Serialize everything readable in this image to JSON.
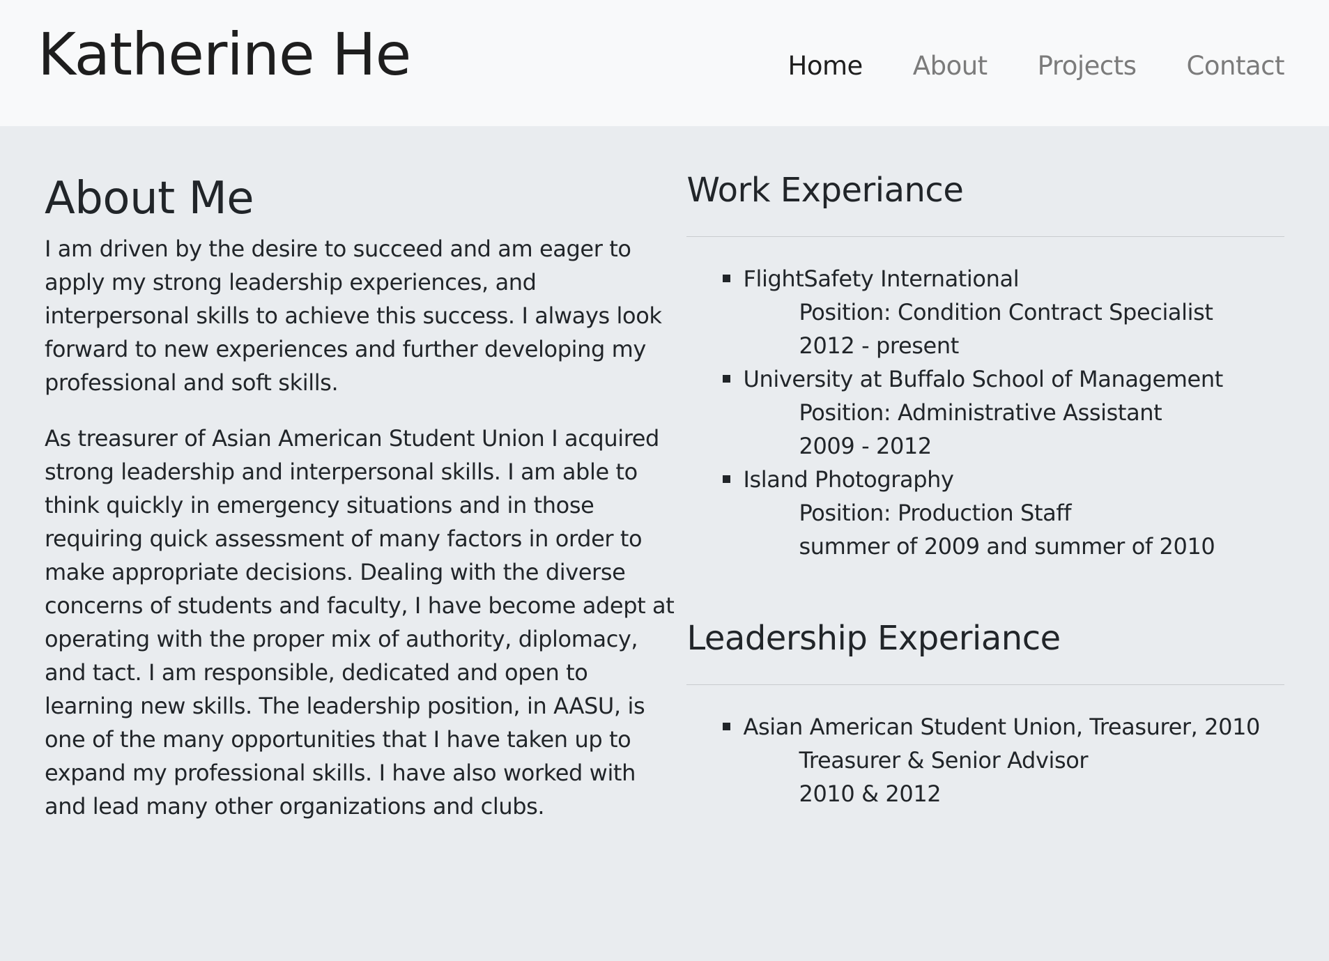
{
  "header": {
    "brand": "Katherine He",
    "nav": [
      "Home",
      "About",
      "Projects",
      "Contact"
    ]
  },
  "about": {
    "title": "About Me",
    "paragraphs": [
      "I am driven by the desire to succeed and am eager to apply my strong leadership experiences, and interpersonal skills to achieve this success. I always look forward to new experiences and further developing my professional and soft skills.",
      "As treasurer of Asian American Student Union I acquired strong leadership and interpersonal skills. I am able to think quickly in emergency situations and in those requiring quick assessment of many factors in order to make appropriate decisions. Dealing with the diverse concerns of students and faculty, I have become adept at operating with the proper mix of authority, diplomacy, and tact. I am responsible, dedicated and open to learning new skills. The leadership position, in AASU, is one of the many opportunities that I have taken up to expand my professional skills. I have also worked with and lead many other organizations and clubs."
    ]
  },
  "work": {
    "title": "Work Experiance",
    "items": [
      {
        "name": "FlightSafety International",
        "position": "Position: Condition Contract Specialist",
        "dates": "2012 - present"
      },
      {
        "name": "University at Buffalo School of Management",
        "position": "Position: Administrative Assistant",
        "dates": "2009 - 2012"
      },
      {
        "name": "Island Photography",
        "position": "Position: Production Staff",
        "dates": "summer of 2009 and summer of 2010"
      }
    ]
  },
  "leadership": {
    "title": "Leadership Experiance",
    "items": [
      {
        "name": "Asian American Student Union, Treasurer, 2010",
        "position": "Treasurer & Senior Advisor",
        "dates": "2010 & 2012"
      }
    ]
  },
  "colors": {
    "header_bg": "#f8f9fa",
    "main_bg": "#e9ecef",
    "text": "#212529",
    "nav_inactive": "#7b7b7b"
  }
}
